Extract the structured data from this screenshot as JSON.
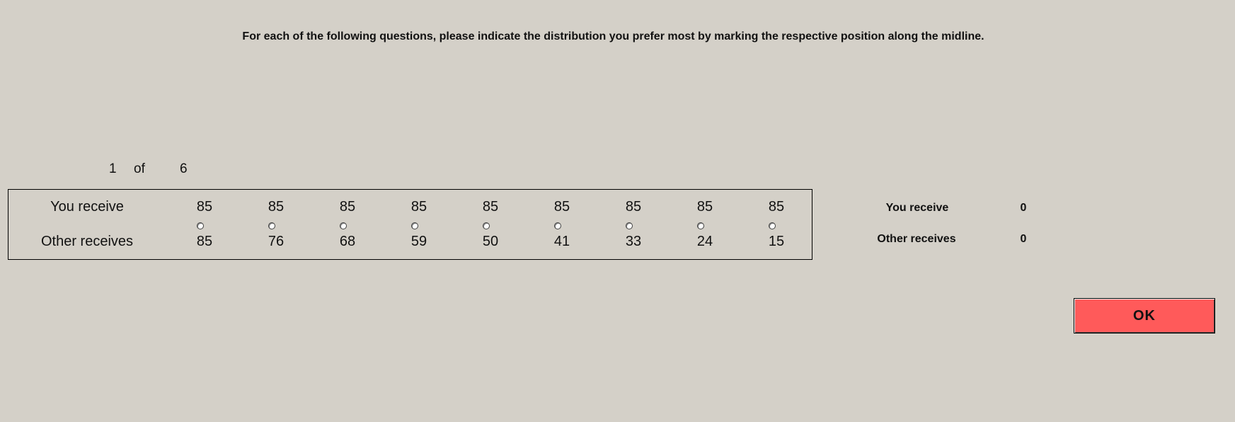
{
  "instruction": "For each of the following questions, please indicate the distribution you prefer most by marking the respective position along the midline.",
  "counter": {
    "current": "1",
    "of_label": "of",
    "total": "6"
  },
  "slider": {
    "you_label": "You receive",
    "other_label": "Other receives",
    "options": [
      {
        "you": "85",
        "other": "85"
      },
      {
        "you": "85",
        "other": "76"
      },
      {
        "you": "85",
        "other": "68"
      },
      {
        "you": "85",
        "other": "59"
      },
      {
        "you": "85",
        "other": "50"
      },
      {
        "you": "85",
        "other": "41"
      },
      {
        "you": "85",
        "other": "33"
      },
      {
        "you": "85",
        "other": "24"
      },
      {
        "you": "85",
        "other": "15"
      }
    ]
  },
  "summary": {
    "you_label": "You receive",
    "you_value": "0",
    "other_label": "Other receives",
    "other_value": "0"
  },
  "ok_button": {
    "label": "OK",
    "color": "#ff5a5a"
  },
  "colors": {
    "background": "#d4d0c8"
  }
}
